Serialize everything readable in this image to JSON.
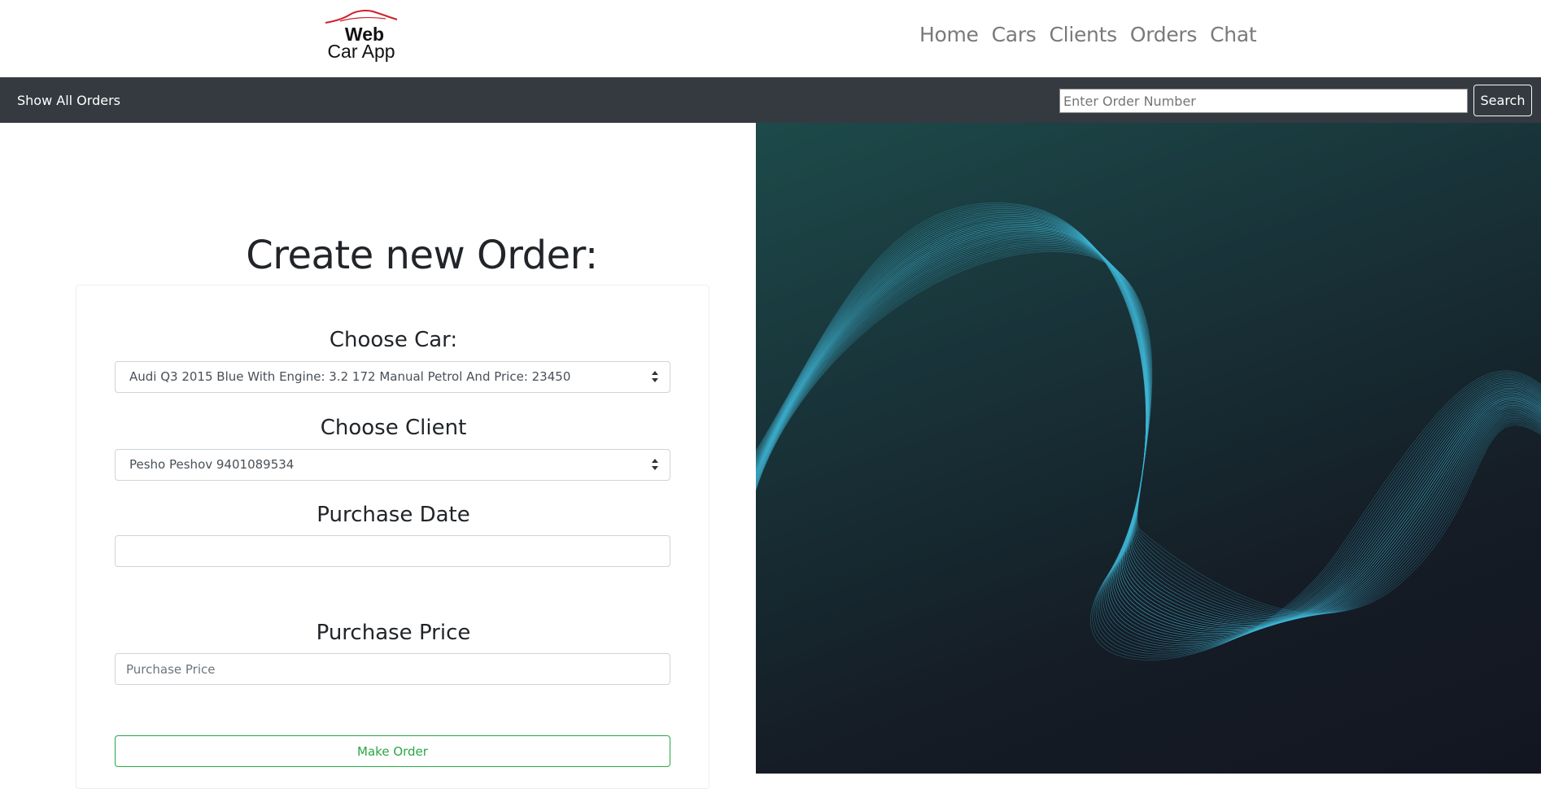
{
  "brand": {
    "line1": "Web",
    "line2": "Car App",
    "accent_color": "#d0202a"
  },
  "topnav": {
    "items": [
      "Home",
      "Cars",
      "Clients",
      "Orders",
      "Chat"
    ]
  },
  "navbar": {
    "show_all_label": "Show All Orders",
    "search_placeholder": "Enter Order Number",
    "search_label": "Search"
  },
  "form": {
    "title": "Create new Order:",
    "car_label": "Choose Car:",
    "car_value": "Audi Q3 2015 Blue With Engine: 3.2 172 Manual Petrol And Price: 23450",
    "client_label": "Choose Client",
    "client_value": "Pesho Peshov 9401089534",
    "date_label": "Purchase Date",
    "date_value": "",
    "price_label": "Purchase Price",
    "price_placeholder": "Purchase Price",
    "submit_label": "Make Order"
  },
  "colors": {
    "dark_nav": "#343a40",
    "success": "#28a745",
    "wave": "#3fb6d6"
  },
  "icons": {
    "logo": "car-outline-icon",
    "select_arrows": "updown-arrows-icon",
    "background": "wave-lines-art"
  }
}
